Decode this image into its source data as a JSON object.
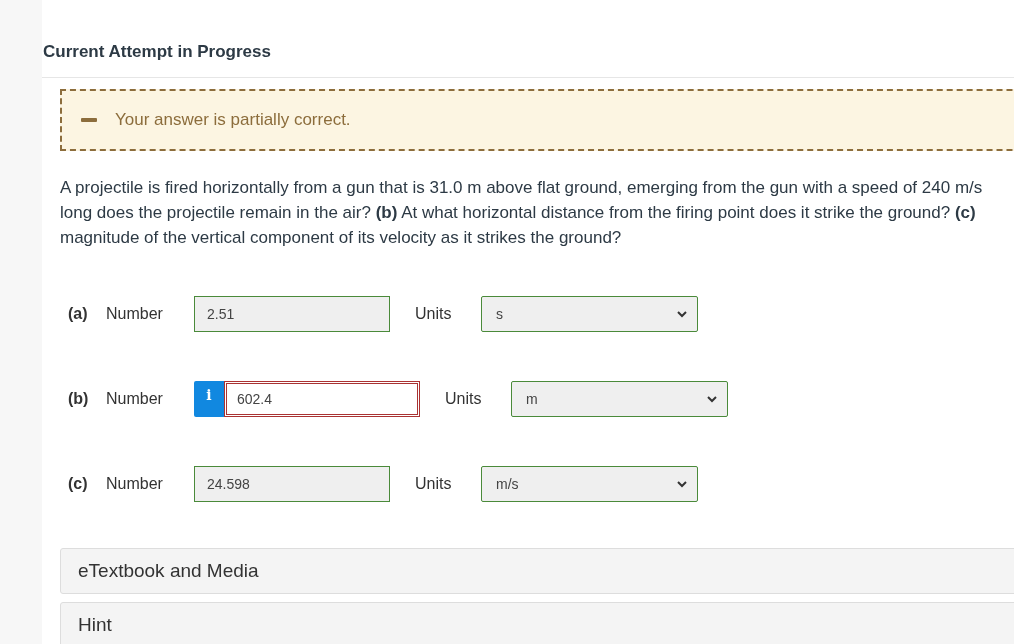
{
  "heading": "Current Attempt in Progress",
  "feedback": {
    "partial": true,
    "message": "Your answer is partially correct."
  },
  "question_lines": [
    "A projectile is fired horizontally from a gun that is 31.0 m above flat ground, emerging from the gun with a speed of 240 m/s",
    "long does the projectile remain in the air? **(b)** At what horizontal distance from the firing point does it strike the ground? **(c)**",
    "magnitude of the vertical component of its velocity as it strikes the ground?"
  ],
  "answers": [
    {
      "part": "(a)",
      "label": "Number",
      "value": "2.51",
      "correct": true,
      "info": false,
      "units_label": "Units",
      "unit": "s",
      "unit_correct": true
    },
    {
      "part": "(b)",
      "label": "Number",
      "value": "602.4",
      "correct": false,
      "info": true,
      "info_symbol": "i",
      "units_label": "Units",
      "unit": "m",
      "unit_correct": true
    },
    {
      "part": "(c)",
      "label": "Number",
      "value": "24.598",
      "correct": true,
      "info": false,
      "units_label": "Units",
      "unit": "m/s",
      "unit_correct": true
    }
  ],
  "panels": [
    {
      "title": "eTextbook and Media"
    },
    {
      "title": "Hint"
    }
  ]
}
